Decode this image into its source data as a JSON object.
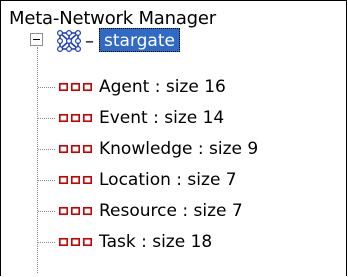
{
  "title": "Meta-Network Manager",
  "root": {
    "label": "stargate",
    "expanded": true,
    "icon": "network-graph-icon"
  },
  "nodesets": [
    {
      "label": "Agent : size 16",
      "icon": "nodeset-icon"
    },
    {
      "label": "Event : size 14",
      "icon": "nodeset-icon"
    },
    {
      "label": "Knowledge : size 9",
      "icon": "nodeset-icon"
    },
    {
      "label": "Location : size 7",
      "icon": "nodeset-icon"
    },
    {
      "label": "Resource : size 7",
      "icon": "nodeset-icon"
    },
    {
      "label": "Task : size 18",
      "icon": "nodeset-icon"
    }
  ],
  "colors": {
    "selection": "#316ac5",
    "nodeset_icon": "#cc0000",
    "network_icon": "#1f3fb4",
    "tree_lines": "#8a8a8a"
  }
}
